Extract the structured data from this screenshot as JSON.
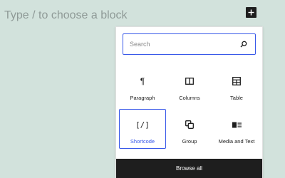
{
  "editor": {
    "placeholder": "Type / to choose a block"
  },
  "inserter_toggle": {
    "icon": "plus-icon"
  },
  "inserter": {
    "search": {
      "placeholder": "Search",
      "value": "",
      "icon": "search-icon"
    },
    "blocks": [
      {
        "label": "Paragraph",
        "icon": "paragraph-icon"
      },
      {
        "label": "Columns",
        "icon": "columns-icon"
      },
      {
        "label": "Table",
        "icon": "table-icon"
      },
      {
        "label": "Shortcode",
        "icon": "shortcode-icon",
        "selected": true
      },
      {
        "label": "Group",
        "icon": "group-icon"
      },
      {
        "label": "Media and Text",
        "icon": "media-text-icon"
      }
    ],
    "browse_all_label": "Browse all"
  },
  "colors": {
    "canvas_bg": "#d2e2dc",
    "accent": "#3858e9",
    "dark": "#1e1e1e"
  }
}
